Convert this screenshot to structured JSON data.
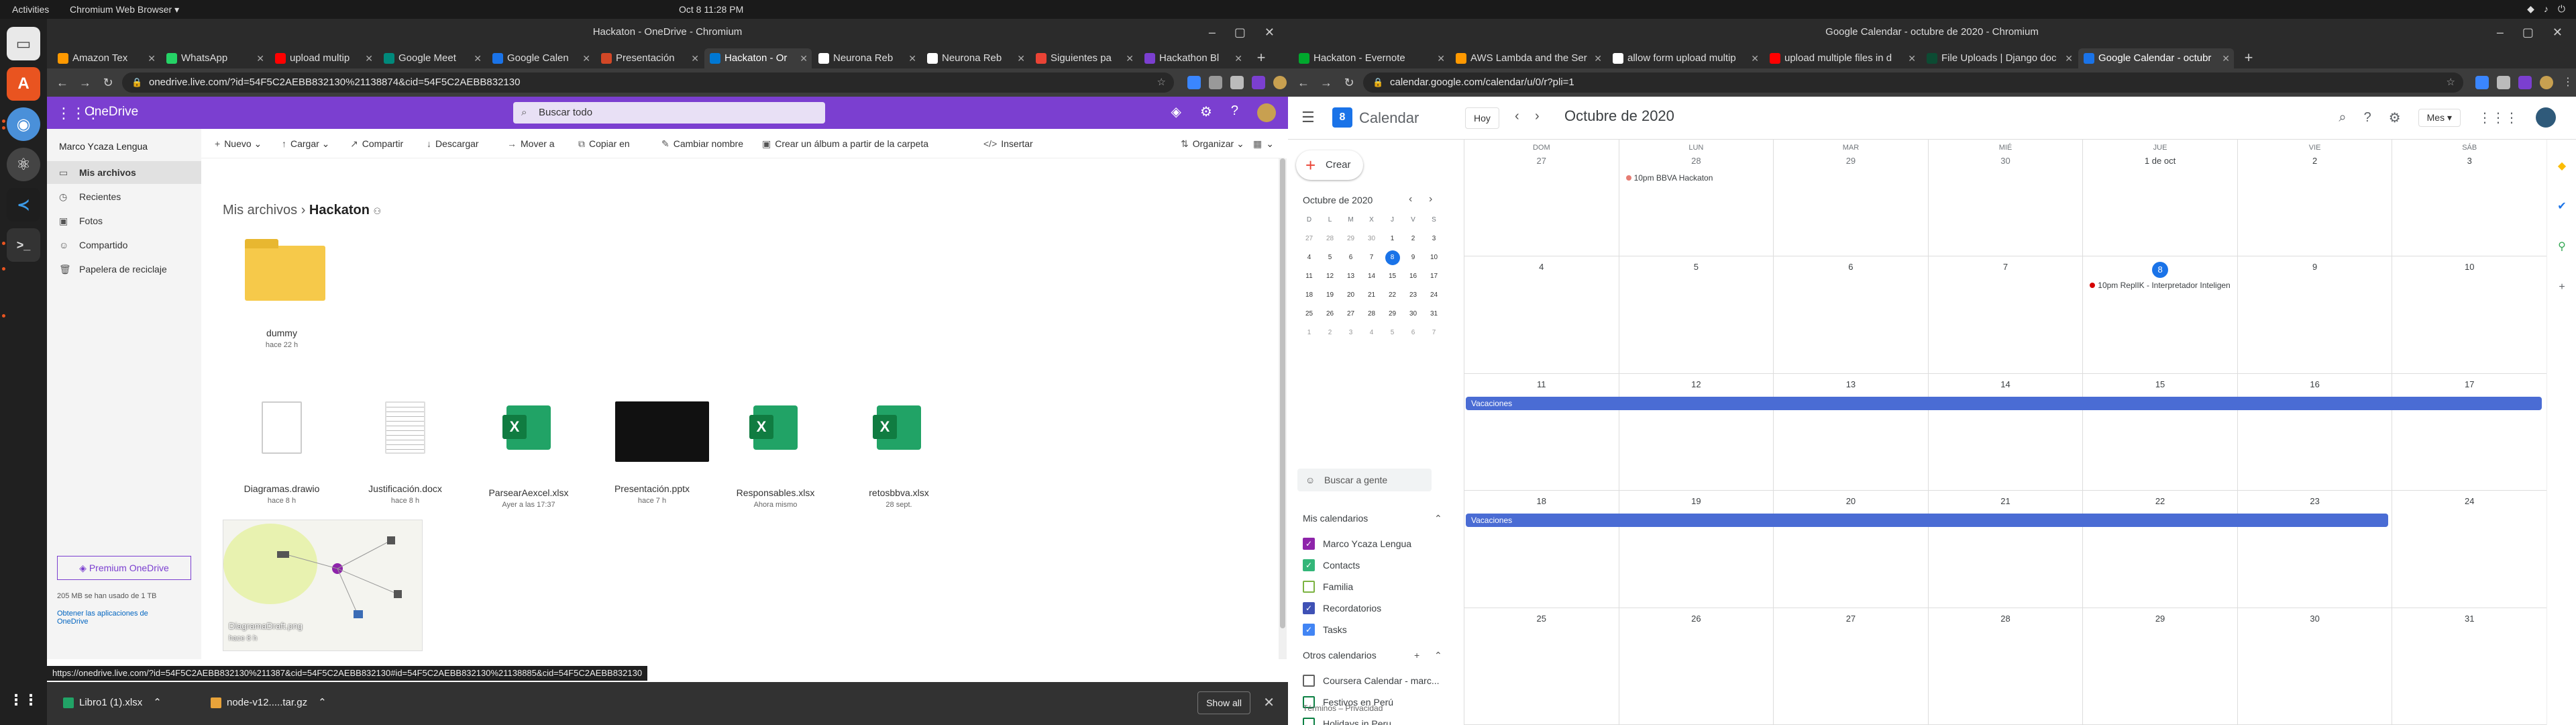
{
  "system": {
    "activities": "Activities",
    "app_menu": "Chromium Web Browser ▾",
    "clock": "Oct 8  11:28 PM"
  },
  "left_window": {
    "title": "Hackaton - OneDrive - Chromium",
    "tabs": [
      {
        "label": "Amazon Tex",
        "color": "#ff9900"
      },
      {
        "label": "WhatsApp",
        "color": "#25d366"
      },
      {
        "label": "upload multip",
        "color": "#ff0000"
      },
      {
        "label": "Google Meet",
        "color": "#00897b"
      },
      {
        "label": "Google Calen",
        "color": "#1a73e8"
      },
      {
        "label": "Presentación",
        "color": "#d24726"
      },
      {
        "label": "Hackaton - Or",
        "color": "#0078d4"
      },
      {
        "label": "Neurona Reb",
        "color": "#ffffff"
      },
      {
        "label": "Neurona Reb",
        "color": "#ffffff"
      },
      {
        "label": "Siguientes pa",
        "color": "#ea4335"
      },
      {
        "label": "Hackathon Bl",
        "color": "#7b3fd0"
      }
    ],
    "url": "onedrive.live.com/?id=54F5C2AEBB832130%21138874&cid=54F5C2AEBB832130",
    "status_url": "https://onedrive.live.com/?id=54F5C2AEBB832130%211387&cid=54F5C2AEBB832130#id=54F5C2AEBB832130%21138885&cid=54F5C2AEBB832130",
    "downloads": [
      {
        "name": "Libro1 (1).xlsx",
        "color": "#21a366"
      },
      {
        "name": "node-v12.....tar.gz",
        "color": "#e8a33a"
      }
    ],
    "show_all": "Show all"
  },
  "onedrive": {
    "brand": "OneDrive",
    "search_placeholder": "Buscar todo",
    "user": "Marco Ycaza Lengua",
    "nav": [
      "Mis archivos",
      "Recientes",
      "Fotos",
      "Compartido",
      "Papelera de reciclaje"
    ],
    "premium": "Premium OneDrive",
    "storage": "205 MB se han usado de 1 TB",
    "get_apps": "Obtener las aplicaciones de OneDrive",
    "commands": [
      "Nuevo",
      "Cargar",
      "Compartir",
      "Descargar",
      "Mover a",
      "Copiar en",
      "Cambiar nombre",
      "Crear un álbum a partir de la carpeta",
      "Insertar"
    ],
    "organize": "Organizar",
    "breadcrumb_root": "Mis archivos",
    "breadcrumb_current": "Hackaton",
    "folder": {
      "name": "dummy",
      "meta": "hace 22 h"
    },
    "files": [
      {
        "name": "Diagramas.drawio",
        "meta": "hace 8 h"
      },
      {
        "name": "Justificación.docx",
        "meta": "hace 8 h"
      },
      {
        "name": "ParsearAexcel.xlsx",
        "meta": "Ayer a las 17:37"
      },
      {
        "name": "Presentación.pptx",
        "meta": "hace 7 h"
      },
      {
        "name": "Responsables.xlsx",
        "meta": "Ahora mismo"
      },
      {
        "name": "retosbbva.xlsx",
        "meta": "28 sept."
      }
    ],
    "image": {
      "name": "DiagramaDraft.png",
      "meta": "hace 8 h"
    }
  },
  "right_window": {
    "title": "Google Calendar - octubre de 2020 - Chromium",
    "tabs": [
      {
        "label": "Hackaton - Evernote",
        "color": "#00a82d"
      },
      {
        "label": "AWS Lambda and the Ser",
        "color": "#ff9900"
      },
      {
        "label": "allow form upload multip",
        "color": "#ffffff"
      },
      {
        "label": "upload multiple files in d",
        "color": "#ff0000"
      },
      {
        "label": "File Uploads | Django doc",
        "color": "#0c4b33"
      },
      {
        "label": "Google Calendar - octubr",
        "color": "#1a73e8"
      }
    ],
    "url": "calendar.google.com/calendar/u/0/r?pli=1"
  },
  "calendar": {
    "brand": "Calendar",
    "today_btn": "Hoy",
    "title": "Octubre de 2020",
    "view": "Mes",
    "create": "Crear",
    "mini_title": "Octubre de 2020",
    "mini_days": [
      "D",
      "L",
      "M",
      "X",
      "J",
      "V",
      "S"
    ],
    "mini_weeks": [
      [
        "27",
        "28",
        "29",
        "30",
        "1",
        "2",
        "3"
      ],
      [
        "4",
        "5",
        "6",
        "7",
        "8",
        "9",
        "10"
      ],
      [
        "11",
        "12",
        "13",
        "14",
        "15",
        "16",
        "17"
      ],
      [
        "18",
        "19",
        "20",
        "21",
        "22",
        "23",
        "24"
      ],
      [
        "25",
        "26",
        "27",
        "28",
        "29",
        "30",
        "31"
      ],
      [
        "1",
        "2",
        "3",
        "4",
        "5",
        "6",
        "7"
      ]
    ],
    "search_people": "Buscar a gente",
    "my_cals_title": "Mis calendarios",
    "my_cals": [
      {
        "name": "Marco Ycaza Lengua",
        "color": "#8e24aa",
        "checked": true
      },
      {
        "name": "Contacts",
        "color": "#33b679",
        "checked": true
      },
      {
        "name": "Familia",
        "color": "#7cb342",
        "checked": false
      },
      {
        "name": "Recordatorios",
        "color": "#3f51b5",
        "checked": true
      },
      {
        "name": "Tasks",
        "color": "#4285f4",
        "checked": true
      }
    ],
    "other_cals_title": "Otros calendarios",
    "other_cals": [
      {
        "name": "Coursera Calendar - marc...",
        "color": "#616161",
        "checked": false
      },
      {
        "name": "Festivos en Perú",
        "color": "#0b8043",
        "checked": false
      },
      {
        "name": "Holidays in Peru",
        "color": "#0b8043",
        "checked": false
      }
    ],
    "terms": "Términos – Privacidad",
    "dows": [
      "DOM",
      "LUN",
      "MAR",
      "MIÉ",
      "JUE",
      "VIE",
      "SÁB"
    ],
    "weeks": [
      [
        "27",
        "28",
        "29",
        "30",
        "1 de oct",
        "2",
        "3"
      ],
      [
        "4",
        "5",
        "6",
        "7",
        "8",
        "9",
        "10"
      ],
      [
        "11",
        "12",
        "13",
        "14",
        "15",
        "16",
        "17"
      ],
      [
        "18",
        "19",
        "20",
        "21",
        "22",
        "23",
        "24"
      ],
      [
        "25",
        "26",
        "27",
        "28",
        "29",
        "30",
        "31"
      ]
    ],
    "events": [
      {
        "text": "10pm BBVA Hackaton",
        "color": "#e67c73"
      },
      {
        "text": "10pm ReplIK - Interpretador Inteligen",
        "color": "#d50000"
      }
    ],
    "vacaciones": "Vacaciones",
    "vacaciones2": "Vacaciones",
    "bar_color": "#4a6cd4"
  }
}
